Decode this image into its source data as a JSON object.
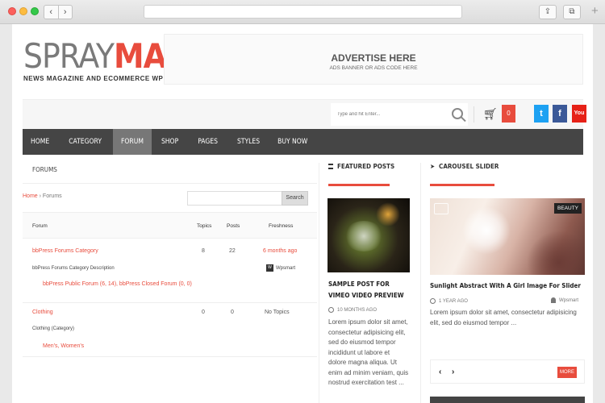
{
  "site": {
    "logo_spray": "SPRAY",
    "logo_mag": "MAG",
    "tagline": "NEWS MAGAZINE AND ECOMMERCE WP THEME"
  },
  "ad": {
    "title": "ADVERTISE HERE",
    "subtitle": "ADS BANNER OR ADS CODE HERE"
  },
  "search": {
    "placeholder": "Type and hit Enter..."
  },
  "cart": {
    "count": "0"
  },
  "social": {
    "twitter": "t",
    "facebook": "f",
    "youtube": "You"
  },
  "nav": [
    "HOME",
    "CATEGORY",
    "FORUM",
    "SHOP",
    "PAGES",
    "STYLES",
    "BUY NOW"
  ],
  "forums": {
    "heading": "FORUMS",
    "breadcrumb_home": "Home",
    "breadcrumb_sep": " › ",
    "breadcrumb_current": "Forums",
    "search_button": "Search",
    "columns": {
      "forum": "Forum",
      "topics": "Topics",
      "posts": "Posts",
      "freshness": "Freshness"
    },
    "rows": [
      {
        "title": "bbPress Forums Category",
        "description": "bbPress Forums Category Description",
        "subforums": "bbPress Public Forum (6, 14), bbPress Closed Forum (0, 0)",
        "topics": "8",
        "posts": "22",
        "freshness": "6 months ago",
        "author": "Wpsmart"
      },
      {
        "title": "Clothing",
        "description": "Clothing (Category)",
        "subforums": "Men's, Women's",
        "topics": "0",
        "posts": "0",
        "freshness": "No Topics"
      }
    ]
  },
  "featured": {
    "heading": "FEATURED POSTS",
    "post_title": "SAMPLE POST FOR VIMEO VIDEO PREVIEW",
    "post_time": "10 MONTHS AGO",
    "post_excerpt": "Lorem ipsum dolor sit amet, consectetur adipisicing elit, sed do eiusmod tempor incididunt ut labore et dolore magna aliqua. Ut enim ad minim veniam, quis nostrud exercitation test ..."
  },
  "carousel": {
    "heading": "CAROUSEL SLIDER",
    "badge": "BEAUTY",
    "title": "Sunlight Abstract With A Girl Image For Slider",
    "time": "1 YEAR AGO",
    "author": "Wpsmart",
    "excerpt": "Lorem ipsum dolor sit amet, consectetur adipisicing elit, sed do eiusmod tempor ...",
    "prev": "‹",
    "next": "›",
    "more": "MORE"
  },
  "colors": {
    "accent": "#e84c3d",
    "nav_bg": "#454545",
    "nav_active": "#777777"
  }
}
